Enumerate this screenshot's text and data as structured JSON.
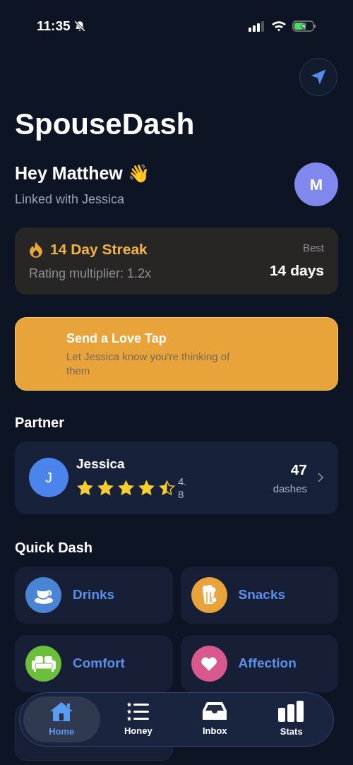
{
  "status_bar": {
    "time": "11:35",
    "silent": true
  },
  "app_title": "SpouseDash",
  "greeting": {
    "title": "Hey Matthew 👋",
    "subtitle": "Linked with Jessica",
    "avatar_initial": "M"
  },
  "streak": {
    "title": "14 Day Streak",
    "subtitle": "Rating multiplier: 1.2x",
    "best_label": "Best",
    "best_value": "14 days"
  },
  "love_tap": {
    "title": "Send a Love Tap",
    "subtitle": "Let Jessica know you're thinking of them"
  },
  "partner_section": {
    "title": "Partner"
  },
  "partner": {
    "initial": "J",
    "name": "Jessica",
    "stars": 4.5,
    "rating": "4.8",
    "count": "47",
    "count_label": "dashes"
  },
  "quick_dash": {
    "title": "Quick Dash",
    "items": [
      {
        "label": "Drinks",
        "color": "#4a84d4"
      },
      {
        "label": "Snacks",
        "color": "#e8a33a"
      },
      {
        "label": "Comfort",
        "color": "#6cbf3a"
      },
      {
        "label": "Affection",
        "color": "#d9598f"
      }
    ]
  },
  "tabs": [
    {
      "label": "Home",
      "selected": true
    },
    {
      "label": "Honey",
      "selected": false
    },
    {
      "label": "Inbox",
      "selected": false
    },
    {
      "label": "Stats",
      "selected": false
    }
  ]
}
